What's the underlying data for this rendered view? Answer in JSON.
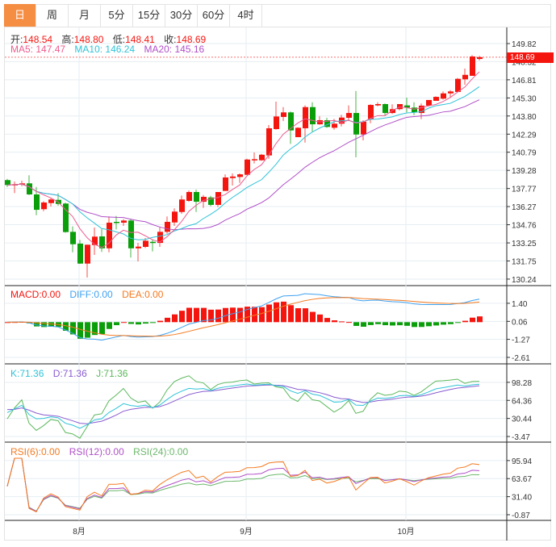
{
  "tabs": [
    {
      "label": "日",
      "active": true
    },
    {
      "label": "周"
    },
    {
      "label": "月"
    },
    {
      "label": "5分"
    },
    {
      "label": "15分"
    },
    {
      "label": "30分"
    },
    {
      "label": "60分"
    },
    {
      "label": "4时"
    }
  ],
  "ohlc_legend": {
    "open_label": "开:",
    "open": "148.54",
    "high_label": "高:",
    "high": "148.80",
    "low_label": "低:",
    "low": "148.41",
    "close_label": "收:",
    "close": "148.69"
  },
  "ma_legend": {
    "ma5": "MA5: 147.47",
    "ma10": "MA10: 146.24",
    "ma20": "MA20: 145.16"
  },
  "macd_legend": {
    "macd": "MACD:0.00",
    "diff": "DIFF:0.00",
    "dea": "DEA:0.00"
  },
  "kdj_legend": {
    "k": "K:71.36",
    "d": "D:71.36",
    "j": "J:71.36"
  },
  "rsi_legend": {
    "rsi6": "RSI(6):0.00",
    "rsi12": "RSI(12):0.00",
    "rsi24": "RSI(24):0.00"
  },
  "current_price": "148.69",
  "colors": {
    "up": "#f5150f",
    "down": "#0a9e0a",
    "accent": "#f58d42",
    "ma5": "#ec5c8f",
    "ma10": "#2fc3d8",
    "ma20": "#b04fc8",
    "diff": "#3fa2f0",
    "dea": "#f47a20",
    "k": "#2fc3d8",
    "d": "#8a5cd0",
    "j": "#5cb85c",
    "rsi6": "#f47a20",
    "rsi12": "#b04fc8",
    "rsi24": "#6cb86c"
  },
  "chart_data": {
    "type": "candlestick",
    "x_ticks": [
      {
        "label": "8月",
        "index": 10
      },
      {
        "label": "9月",
        "index": 33
      },
      {
        "label": "10月",
        "index": 55
      }
    ],
    "candles": [
      [
        138.47,
        138.57,
        137.9,
        138.06
      ],
      [
        138.06,
        138.35,
        137.39,
        138.13
      ],
      [
        138.13,
        138.42,
        137.97,
        138.2
      ],
      [
        138.2,
        138.87,
        137.23,
        137.28
      ],
      [
        137.28,
        137.9,
        135.55,
        136.0
      ],
      [
        136.05,
        136.72,
        135.89,
        136.61
      ],
      [
        136.56,
        136.94,
        136.27,
        136.86
      ],
      [
        136.83,
        137.39,
        136.34,
        136.49
      ],
      [
        136.52,
        136.6,
        134.1,
        134.15
      ],
      [
        134.17,
        134.62,
        132.47,
        133.14
      ],
      [
        133.19,
        133.5,
        131.5,
        131.53
      ],
      [
        131.53,
        133.1,
        130.37,
        133.1
      ],
      [
        133.07,
        134.53,
        132.25,
        133.77
      ],
      [
        133.79,
        134.39,
        132.5,
        132.8
      ],
      [
        132.8,
        135.45,
        132.47,
        134.93
      ],
      [
        135.0,
        135.49,
        134.37,
        134.93
      ],
      [
        134.93,
        135.22,
        134.66,
        135.11
      ],
      [
        135.11,
        135.27,
        132.03,
        132.8
      ],
      [
        132.8,
        133.25,
        131.71,
        132.94
      ],
      [
        132.92,
        133.66,
        132.83,
        133.43
      ],
      [
        133.34,
        133.54,
        132.54,
        133.27
      ],
      [
        133.25,
        134.55,
        132.92,
        134.17
      ],
      [
        134.17,
        135.45,
        134.02,
        135.0
      ],
      [
        134.95,
        136.12,
        134.66,
        135.85
      ],
      [
        135.82,
        137.19,
        135.67,
        136.86
      ],
      [
        136.74,
        137.61,
        136.67,
        137.48
      ],
      [
        137.48,
        137.68,
        135.82,
        136.67
      ],
      [
        136.67,
        137.23,
        136.16,
        137.08
      ],
      [
        137.03,
        137.16,
        136.29,
        136.41
      ],
      [
        136.41,
        137.48,
        136.23,
        137.48
      ],
      [
        137.57,
        138.95,
        137.57,
        138.69
      ],
      [
        138.64,
        139.02,
        138.02,
        138.77
      ],
      [
        138.73,
        139.02,
        138.24,
        138.95
      ],
      [
        138.91,
        140.25,
        138.91,
        140.18
      ],
      [
        140.12,
        140.77,
        139.85,
        140.21
      ],
      [
        140.12,
        140.65,
        140.07,
        140.58
      ],
      [
        140.52,
        143.05,
        140.25,
        142.78
      ],
      [
        142.71,
        144.99,
        142.66,
        143.76
      ],
      [
        143.72,
        144.54,
        143.38,
        144.1
      ],
      [
        144.1,
        144.17,
        141.48,
        142.6
      ],
      [
        142.04,
        142.86,
        142.04,
        142.82
      ],
      [
        142.78,
        144.68,
        141.59,
        144.54
      ],
      [
        144.54,
        144.94,
        142.49,
        143.11
      ],
      [
        143.11,
        143.78,
        143.07,
        143.45
      ],
      [
        143.45,
        143.65,
        142.82,
        142.89
      ],
      [
        142.82,
        143.56,
        142.66,
        143.16
      ],
      [
        143.16,
        143.9,
        142.93,
        143.67
      ],
      [
        143.65,
        144.68,
        143.38,
        144.05
      ],
      [
        144.05,
        145.88,
        140.36,
        142.26
      ],
      [
        142.26,
        143.45,
        141.77,
        143.33
      ],
      [
        143.56,
        144.77,
        143.2,
        144.72
      ],
      [
        144.68,
        144.94,
        144.61,
        144.79
      ],
      [
        144.79,
        144.84,
        143.87,
        144.05
      ],
      [
        144.05,
        144.77,
        143.96,
        144.37
      ],
      [
        144.37,
        144.79,
        144.27,
        144.79
      ],
      [
        144.68,
        145.33,
        144.1,
        144.5
      ],
      [
        144.5,
        144.94,
        143.87,
        144.12
      ],
      [
        144.05,
        144.84,
        143.54,
        144.66
      ],
      [
        144.66,
        145.13,
        144.61,
        145.13
      ],
      [
        145.06,
        145.44,
        145.06,
        145.39
      ],
      [
        145.24,
        145.84,
        145.17,
        145.68
      ],
      [
        145.68,
        145.95,
        145.35,
        145.84
      ],
      [
        145.8,
        146.96,
        145.8,
        146.89
      ],
      [
        146.85,
        147.74,
        146.4,
        147.22
      ],
      [
        147.14,
        148.86,
        147.14,
        148.75
      ],
      [
        148.54,
        148.8,
        148.41,
        148.69
      ]
    ],
    "candle_fields": [
      "open",
      "high",
      "low",
      "close"
    ],
    "price_axis": {
      "ticks": [
        "149.82",
        "148.32",
        "146.81",
        "145.30",
        "143.80",
        "142.29",
        "140.79",
        "139.28",
        "137.77",
        "136.27",
        "134.76",
        "133.25",
        "131.75",
        "130.24"
      ],
      "range": [
        129.7,
        150.76
      ]
    },
    "macd_axis": {
      "ticks": [
        "1.40",
        "0.06",
        "-1.27",
        "-2.61"
      ],
      "range": [
        -3.09,
        2.65
      ]
    },
    "kdj_axis": {
      "ticks": [
        "98.28",
        "64.36",
        "30.44",
        "-3.47"
      ],
      "range": [
        -14,
        131.4
      ]
    },
    "rsi_axis": {
      "ticks": [
        "95.94",
        "63.67",
        "31.40",
        "-0.87"
      ],
      "range": [
        -11,
        127.5
      ]
    }
  }
}
